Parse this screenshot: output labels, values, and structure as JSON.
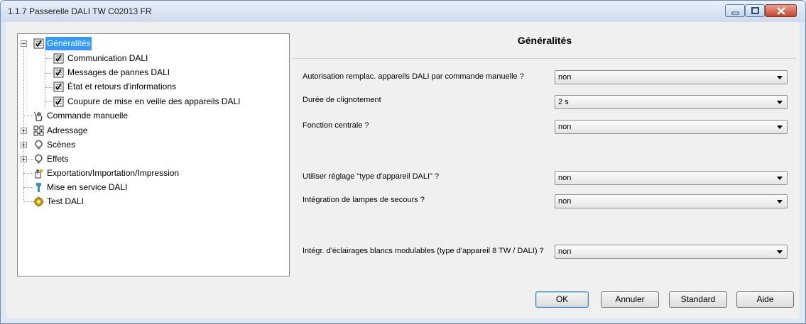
{
  "window": {
    "title": "1.1.7 Passerelle DALI TW C02013 FR"
  },
  "tree": {
    "items": [
      {
        "label": "Généralités",
        "icon": "checklist-icon",
        "selected": true
      },
      {
        "label": "Communication DALI",
        "icon": "checklist-icon"
      },
      {
        "label": "Messages de pannes DALI",
        "icon": "checklist-icon"
      },
      {
        "label": "État et retours d'informations",
        "icon": "checklist-icon"
      },
      {
        "label": "Coupure de mise en veille des appareils DALI",
        "icon": "checklist-icon"
      },
      {
        "label": "Commande manuelle",
        "icon": "hand-icon"
      },
      {
        "label": "Adressage",
        "icon": "grid-icon"
      },
      {
        "label": "Scènes",
        "icon": "bulb-icon"
      },
      {
        "label": "Effets",
        "icon": "bulb-icon"
      },
      {
        "label": "Exportation/Importation/Impression",
        "icon": "export-icon"
      },
      {
        "label": "Mise en service DALI",
        "icon": "wrench-icon"
      },
      {
        "label": "Test DALI",
        "icon": "gear-icon"
      }
    ]
  },
  "panel": {
    "title": "Généralités",
    "params": [
      {
        "label": "Autorisation remplac. appareils DALI par commande manuelle ?",
        "value": "non"
      },
      {
        "label": "Durée de clignotement",
        "value": "2 s"
      },
      {
        "label": "Fonction centrale ?",
        "value": "non"
      },
      {
        "label": "Utiliser  réglage \"type d'appareil DALI\" ?",
        "value": "non"
      },
      {
        "label": "Intégration de lampes de secours ?",
        "value": "non"
      },
      {
        "label": "Intégr. d'éclairages blancs modulables  (type d'appareil 8 TW / DALI) ?",
        "value": "non"
      }
    ]
  },
  "buttons": {
    "ok": "OK",
    "cancel": "Annuler",
    "standard": "Standard",
    "help": "Aide"
  },
  "colors": {
    "selection": "#3399ff",
    "close_button": "#c4432e",
    "titlebar": "#dbe6f3"
  }
}
